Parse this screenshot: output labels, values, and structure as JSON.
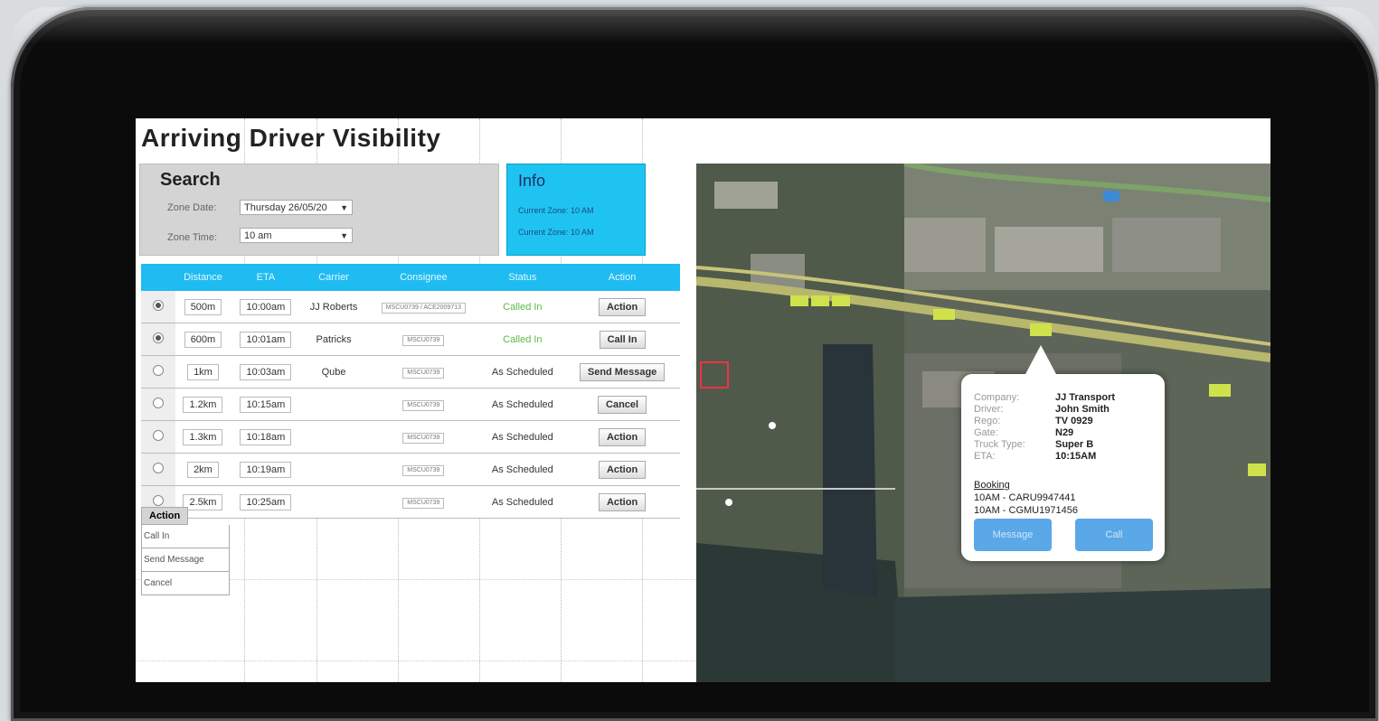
{
  "page": {
    "title": "Arriving Driver Visibility"
  },
  "search": {
    "heading": "Search",
    "zone_date_label": "Zone Date:",
    "zone_date_value": "Thursday 26/05/20",
    "zone_time_label": "Zone Time:",
    "zone_time_value": "10 am"
  },
  "info": {
    "heading": "Info",
    "line1": "Current Zone: 10 AM",
    "line2": "Current Zone: 10 AM"
  },
  "table": {
    "headers": [
      "",
      "Distance",
      "ETA",
      "Carrier",
      "Consignee",
      "Status",
      "Action"
    ],
    "rows": [
      {
        "selected": true,
        "distance": "500m",
        "eta": "10:00am",
        "carrier": "JJ Roberts",
        "consignee": "MSCU0739 / ACE2009713",
        "status": "Called In",
        "status_color": "#5cb84a",
        "action": "Action"
      },
      {
        "selected": true,
        "distance": "600m",
        "eta": "10:01am",
        "carrier": "Patricks",
        "consignee": "MSCU0739",
        "status": "Called In",
        "status_color": "#5cb84a",
        "action": "Call In"
      },
      {
        "selected": false,
        "distance": "1km",
        "eta": "10:03am",
        "carrier": "Qube",
        "consignee": "MSCU0739",
        "status": "As Scheduled",
        "status_color": "#333333",
        "action": "Send Message"
      },
      {
        "selected": false,
        "distance": "1.2km",
        "eta": "10:15am",
        "carrier": "",
        "consignee": "MSCU0739",
        "status": "As Scheduled",
        "status_color": "#333333",
        "action": "Cancel"
      },
      {
        "selected": false,
        "distance": "1.3km",
        "eta": "10:18am",
        "carrier": "",
        "consignee": "MSCU0739",
        "status": "As Scheduled",
        "status_color": "#333333",
        "action": "Action"
      },
      {
        "selected": false,
        "distance": "2km",
        "eta": "10:19am",
        "carrier": "",
        "consignee": "MSCU0739",
        "status": "As Scheduled",
        "status_color": "#333333",
        "action": "Action"
      },
      {
        "selected": false,
        "distance": "2.5km",
        "eta": "10:25am",
        "carrier": "",
        "consignee": "MSCU0739",
        "status": "As Scheduled",
        "status_color": "#333333",
        "action": "Action"
      }
    ]
  },
  "action_menu": {
    "header": "Action",
    "items": [
      "Call In",
      "Send Message",
      "Cancel"
    ]
  },
  "popup": {
    "company_label": "Company:",
    "company": "JJ Transport",
    "driver_label": "Driver:",
    "driver": "John Smith",
    "rego_label": "Rego:",
    "rego": "TV 0929",
    "gate_label": "Gate:",
    "gate": "N29",
    "truck_label": "Truck Type:",
    "truck": "Super B",
    "eta_label": "ETA:",
    "eta": "10:15AM",
    "booking_label": "Booking",
    "booking1": "10AM - CARU9947441",
    "booking2": "10AM - CGMU1971456",
    "message_btn": "Message",
    "call_btn": "Call"
  },
  "colors": {
    "accent": "#1fbcf2",
    "called_in": "#5cb84a"
  }
}
